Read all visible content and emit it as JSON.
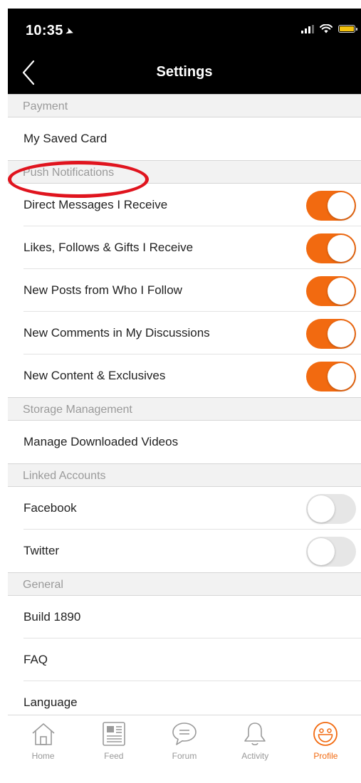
{
  "status_bar": {
    "time": "10:35",
    "location_glyph": "➤"
  },
  "nav": {
    "title": "Settings"
  },
  "sections": {
    "payment": {
      "header": "Payment",
      "items": {
        "saved_card": "My Saved Card"
      }
    },
    "push_notifications": {
      "header": "Push Notifications",
      "items": [
        {
          "label": "Direct Messages I Receive",
          "enabled": true
        },
        {
          "label": "Likes, Follows & Gifts I Receive",
          "enabled": true
        },
        {
          "label": "New Posts from Who I Follow",
          "enabled": true
        },
        {
          "label": "New Comments in My Discussions",
          "enabled": true
        },
        {
          "label": "New Content & Exclusives",
          "enabled": true
        }
      ]
    },
    "storage": {
      "header": "Storage Management",
      "items": {
        "downloads": "Manage Downloaded Videos"
      }
    },
    "linked_accounts": {
      "header": "Linked Accounts",
      "items": [
        {
          "label": "Facebook",
          "enabled": false
        },
        {
          "label": "Twitter",
          "enabled": false
        }
      ]
    },
    "general": {
      "header": "General",
      "items": {
        "build": "Build 1890",
        "faq": "FAQ",
        "language": "Language"
      }
    }
  },
  "tab_bar": {
    "tabs": [
      {
        "label": "Home",
        "icon": "home-icon",
        "active": false
      },
      {
        "label": "Feed",
        "icon": "feed-icon",
        "active": false
      },
      {
        "label": "Forum",
        "icon": "forum-icon",
        "active": false
      },
      {
        "label": "Activity",
        "icon": "bell-icon",
        "active": false
      },
      {
        "label": "Profile",
        "icon": "smiley-icon",
        "active": true
      }
    ]
  },
  "colors": {
    "accent": "#f26a10",
    "highlight": "#e0141e",
    "toggle_off": "#e6e6e6"
  }
}
